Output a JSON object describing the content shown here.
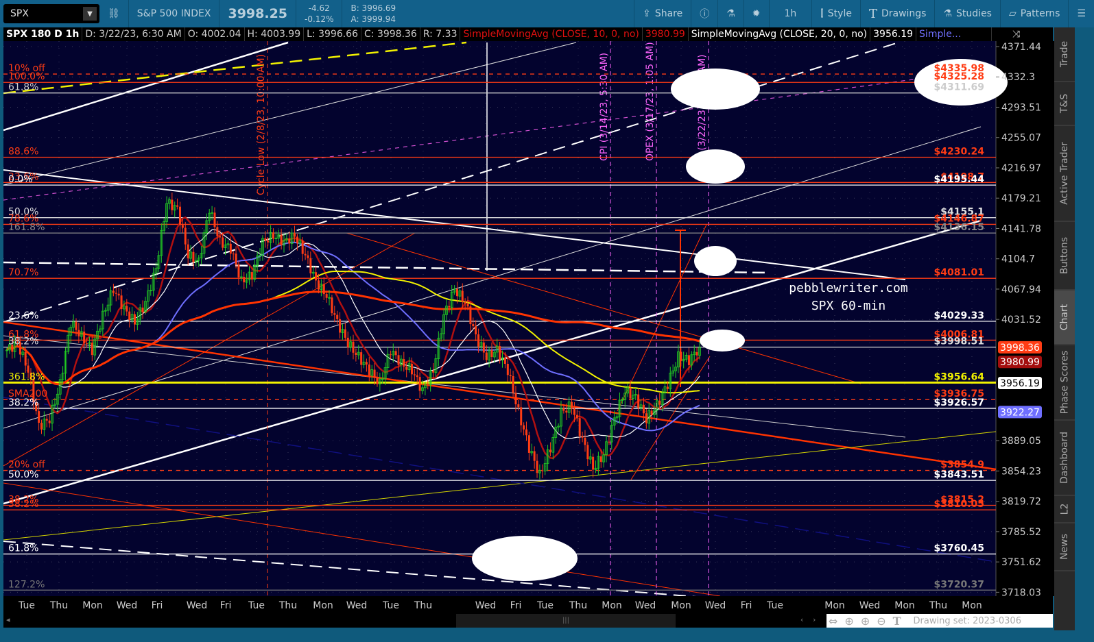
{
  "toolbar": {
    "symbol": "SPX",
    "name": "S&P 500 INDEX",
    "last": "3998.25",
    "change": "-4.62",
    "change_pct": "-0.12%",
    "bid": "B: 3996.69",
    "ask": "A: 3999.94",
    "share": "Share",
    "interval": "1h",
    "style": "Style",
    "drawings": "Drawings",
    "studies": "Studies",
    "patterns": "Patterns"
  },
  "header": {
    "title": "SPX 180 D 1h",
    "date": "D: 3/22/23, 6:30 AM",
    "open": "O: 4002.04",
    "high": "H: 4003.99",
    "low": "L: 3996.66",
    "close": "C: 3998.36",
    "range": "R: 7.33",
    "sma10": "SimpleMovingAvg (CLOSE, 10, 0, no)",
    "sma10_val": "3980.99",
    "sma20": "SimpleMovingAvg (CLOSE, 20, 0, no)",
    "sma20_val": "3956.19",
    "more": "Simple..."
  },
  "sidebar": [
    "Trade",
    "T&S",
    "Active Trader",
    "Buttons",
    "Chart",
    "Phase Scores",
    "Dashboard",
    "L2",
    "News"
  ],
  "price_axis": [
    "4371.44",
    "4332.3",
    "4293.51",
    "4255.07",
    "4216.97",
    "4179.21",
    "4141.78",
    "4104.7",
    "4067.94",
    "4031.52",
    "3889.05",
    "3854.23",
    "3819.72",
    "3785.52",
    "3751.62",
    "3718.03"
  ],
  "price_tags": [
    {
      "text": "3998.36",
      "bg": "#ff3c14",
      "fg": "#fff"
    },
    {
      "text": "3980.99",
      "bg": "#a30e0e",
      "fg": "#fff"
    },
    {
      "text": "3956.19",
      "bg": "#ffffff",
      "fg": "#000"
    },
    {
      "text": "3922.27",
      "bg": "#6f6fff",
      "fg": "#fff"
    }
  ],
  "levels": [
    {
      "price": 4335.98,
      "right": "$4335.98",
      "left": "10% off",
      "color": "#ff3c14",
      "dash": true
    },
    {
      "price": 4325.28,
      "right": "$4325.28",
      "left": "100.0%",
      "color": "#ff3c14"
    },
    {
      "price": 4311.69,
      "right": "$4311.69",
      "left": "61.8%",
      "color": "#cccccc"
    },
    {
      "price": 4230.24,
      "right": "$4230.24",
      "left": "88.6%",
      "color": "#ff3c14"
    },
    {
      "price": 4198.7,
      "right": "$4198.7",
      "left": "23.6%",
      "color": "#ff3c14"
    },
    {
      "price": 4195.44,
      "right": "$4195.44",
      "left": "0.0%",
      "color": "#ffffff"
    },
    {
      "price": 4155.1,
      "right": "$4155.1",
      "left": "50.0%",
      "color": "#dddddd"
    },
    {
      "price": 4146.87,
      "right": "$4146.87",
      "left": "78.6%",
      "color": "#ff3c14"
    },
    {
      "price": 4136.15,
      "right": "$4136.15",
      "left": "161.8%",
      "color": "#888888"
    },
    {
      "price": 4081.01,
      "right": "$4081.01",
      "left": "70.7%",
      "color": "#ff3c14"
    },
    {
      "price": 4029.33,
      "right": "$4029.33",
      "left": "23.6%",
      "color": "#ffffff"
    },
    {
      "price": 4006.81,
      "right": "$4006.81",
      "left": "61.8%",
      "color": "#ff3c14"
    },
    {
      "price": 3998.51,
      "right": "$3998.51",
      "left": "38.2%",
      "color": "#dddddd"
    },
    {
      "price": 3956.64,
      "right": "$3956.64",
      "left": "361.8%",
      "color": "#f2f200",
      "thick": true
    },
    {
      "price": 3936.75,
      "right": "$3936.75",
      "left": "SMA200",
      "color": "#ff3c14",
      "dash": true
    },
    {
      "price": 3926.57,
      "right": "$3926.57",
      "left": "38.2%",
      "color": "#ffffff"
    },
    {
      "price": 3854.9,
      "right": "$3854.9",
      "left": "20% off",
      "color": "#ff3c14",
      "dash": true
    },
    {
      "price": 3843.51,
      "right": "$3843.51",
      "left": "50.0%",
      "color": "#ffffff"
    },
    {
      "price": 3815.2,
      "right": "$3815.2",
      "left": "38.2%",
      "color": "#ff3c14"
    },
    {
      "price": 3810.05,
      "right": "$3810.05",
      "left": "38.2%",
      "color": "#ff3c14"
    },
    {
      "price": 3760.45,
      "right": "$3760.45",
      "left": "61.8%",
      "color": "#ffffff"
    },
    {
      "price": 3720.37,
      "right": "$3720.37",
      "left": "127.2%",
      "color": "#777777"
    }
  ],
  "events": [
    {
      "label": "Cycle Low (2/8/23, 10:00 AM)",
      "color": "#ff3c14"
    },
    {
      "label": "CPI (3/14/23, 5:30 AM)",
      "color": "#ff66ff"
    },
    {
      "label": "OPEX (3/17/23, 1:05 AM)",
      "color": "#ff66ff"
    },
    {
      "label": "FOMC (3/22/23, 10:00 AM)",
      "color": "#ff66ff"
    }
  ],
  "watermark": {
    "line1": "pebblewriter.com",
    "line2": "SPX 60-min"
  },
  "x_axis": [
    "Tue",
    "Thu",
    "Mon",
    "Wed",
    "Fri",
    "Wed",
    "Fri",
    "Tue",
    "Thu",
    "Mon",
    "Wed",
    "Tue",
    "Thu",
    "Wed",
    "Fri",
    "Tue",
    "Thu",
    "Mon",
    "Wed",
    "Mon",
    "Wed",
    "Fri",
    "Tue",
    "Mon",
    "Wed",
    "Mon",
    "Thu",
    "Mon"
  ],
  "footer": {
    "drawing_set": "Drawing set: 2023-0306"
  },
  "chart_data": {
    "type": "candlestick",
    "title": "SPX 180 D 1h",
    "y_scale": "log",
    "ylim": [
      3718.03,
      4371.44
    ],
    "close_path": [
      3995,
      4003,
      3971,
      3906,
      3914,
      3955,
      4028,
      4011,
      3995,
      4036,
      4068,
      4044,
      4028,
      4052,
      4093,
      4174,
      4166,
      4109,
      4101,
      4166,
      4125,
      4117,
      4077,
      4085,
      4125,
      4133,
      4125,
      4133,
      4109,
      4077,
      4060,
      4028,
      4003,
      3987,
      3971,
      3955,
      3995,
      3979,
      3971,
      3947,
      3971,
      4036,
      4068,
      4052,
      4011,
      3987,
      3995,
      3971,
      3922,
      3881,
      3849,
      3881,
      3922,
      3930,
      3890,
      3857,
      3873,
      3914,
      3947,
      3939,
      3914,
      3930,
      3955,
      3987,
      3983,
      3998
    ],
    "moving_averages": [
      {
        "name": "SMA10",
        "color": "#b01010"
      },
      {
        "name": "SMA20",
        "color": "#ffffff"
      },
      {
        "name": "SMA50",
        "color": "#6f6fff"
      },
      {
        "name": "SMA100",
        "color": "#f2f200"
      },
      {
        "name": "SMA200",
        "color": "#ff3300"
      }
    ]
  }
}
